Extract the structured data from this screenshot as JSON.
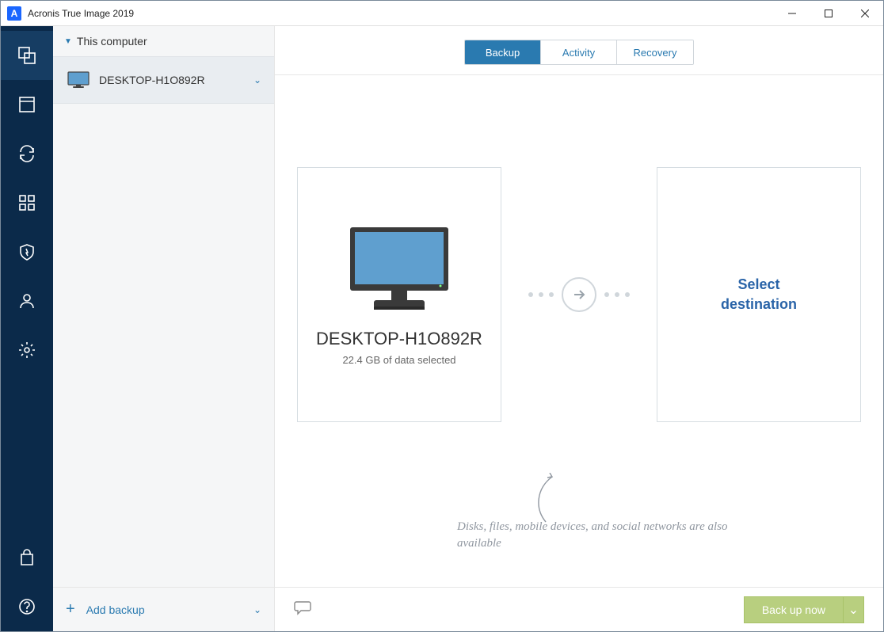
{
  "titlebar": {
    "title": "Acronis True Image 2019",
    "logo_letter": "A"
  },
  "sidebar": {
    "header": "This computer",
    "item": {
      "name": "DESKTOP-H1O892R"
    },
    "add_label": "Add backup"
  },
  "tabs": {
    "t0": "Backup",
    "t1": "Activity",
    "t2": "Recovery"
  },
  "source_panel": {
    "title": "DESKTOP-H1O892R",
    "subtitle": "22.4 GB of data selected"
  },
  "dest_panel": {
    "line1": "Select",
    "line2": "destination"
  },
  "hint": "Disks, files, mobile devices, and social networks are also available",
  "footer": {
    "backup_now": "Back up now"
  }
}
